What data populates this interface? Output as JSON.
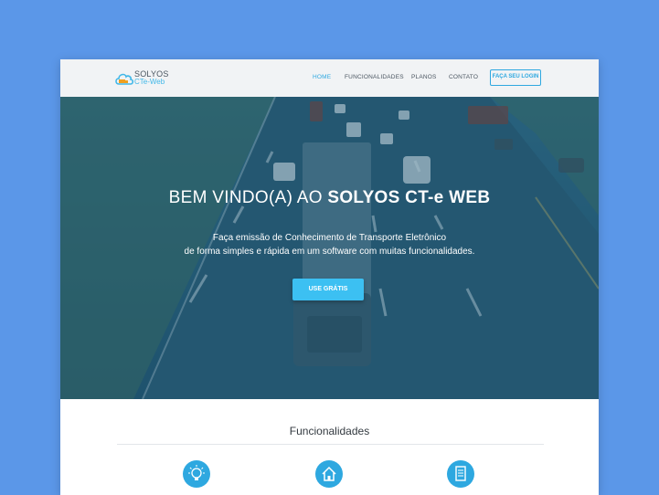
{
  "logo": {
    "line1": "SOLYOS",
    "line2": "CTe-Web"
  },
  "nav": {
    "items": [
      "HOME",
      "FUNCIONALIDADES",
      "PLANOS",
      "CONTATO"
    ],
    "active": "HOME",
    "login_label": "FAÇA SEU LOGIN"
  },
  "hero": {
    "title_prefix": "BEM VINDO(A) AO ",
    "title_strong": "SOLYOS CT-e WEB",
    "subtitle_line1": "Faça emissão de Conhecimento de Transporte Eletrônico",
    "subtitle_line2": "de forma simples e rápida em um software com muitas funcionalidades.",
    "cta_label": "USE GRÁTIS"
  },
  "features": {
    "title": "Funcionalidades",
    "icons": [
      "lightbulb-icon",
      "home-icon",
      "document-icon"
    ]
  },
  "colors": {
    "background": "#5b97e8",
    "accent": "#2ea8e0",
    "cta": "#3cc0f2",
    "hero_overlay": "#1f5a78"
  }
}
